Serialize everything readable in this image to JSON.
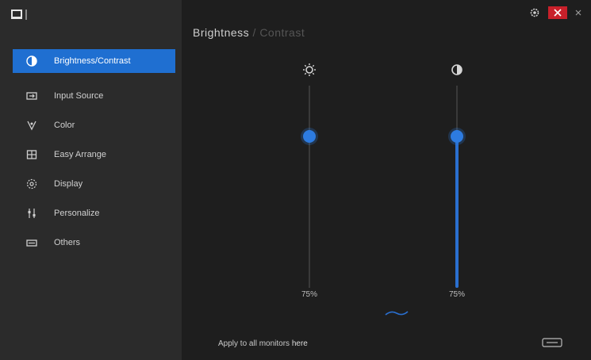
{
  "app": {
    "logo_icon": "monitor-logo-icon"
  },
  "window_controls": {
    "settings_icon": "gear-icon",
    "close_icon": "close-icon",
    "minimize_icon": "minimize-icon",
    "close_color": "#c8202a"
  },
  "header": {
    "title": "Brightness",
    "subtitle": "/ Contrast"
  },
  "sidebar": {
    "accent": "#1f6fd1",
    "items": [
      {
        "label": "Brightness/Contrast",
        "icon": "brightness-icon",
        "active": true
      },
      {
        "label": "Input Source",
        "icon": "input-source-icon",
        "active": false
      },
      {
        "label": "Color",
        "icon": "color-icon",
        "active": false
      },
      {
        "label": "Easy Arrange",
        "icon": "easy-arrange-icon",
        "active": false
      },
      {
        "label": "Display",
        "icon": "display-icon",
        "active": false
      },
      {
        "label": "Personalize",
        "icon": "personalize-icon",
        "active": false
      },
      {
        "label": "Others",
        "icon": "others-icon",
        "active": false
      }
    ]
  },
  "sliders": {
    "brightness": {
      "icon": "sun-icon",
      "value": 75,
      "value_label": "75%"
    },
    "contrast": {
      "icon": "contrast-icon",
      "value": 75,
      "value_label": "75%"
    }
  },
  "footer": {
    "text": "Apply to all monitors ",
    "link": "here",
    "help_icon": "info-icon"
  }
}
